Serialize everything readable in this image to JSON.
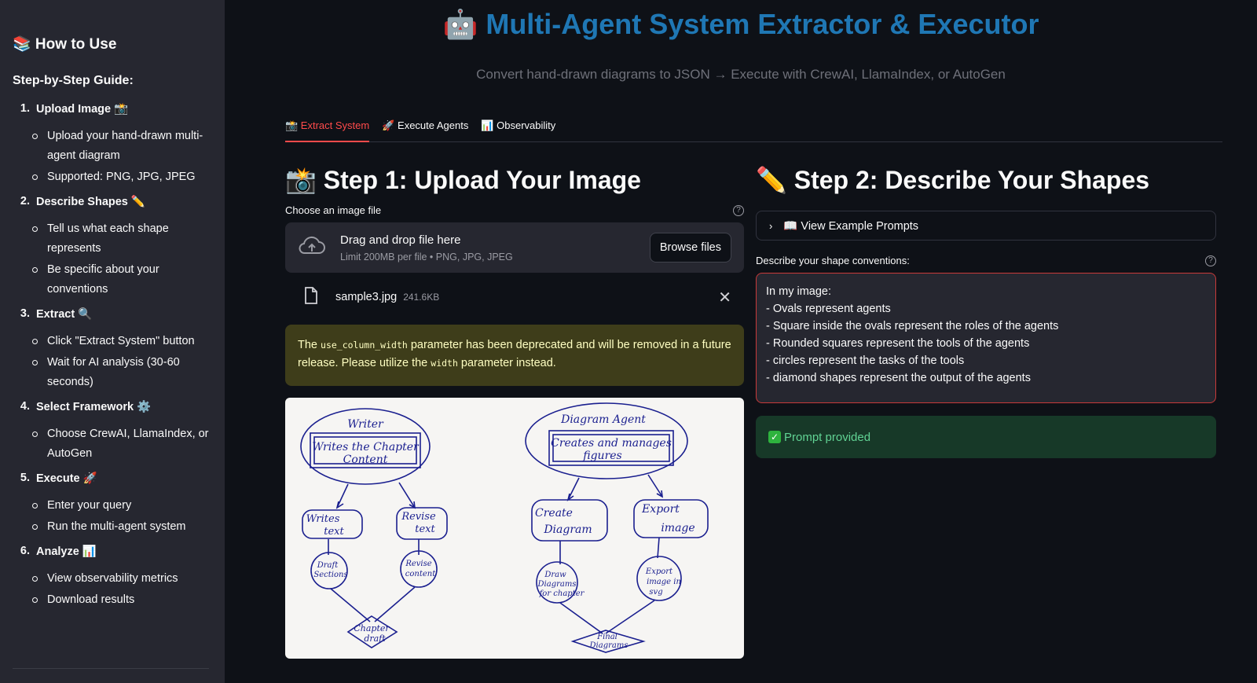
{
  "sidebar": {
    "title": "📚 How to Use",
    "guide_heading": "Step-by-Step Guide:",
    "steps": [
      {
        "num": "1.",
        "label": "Upload Image 📸",
        "bullets": [
          "Upload your hand-drawn multi-agent diagram",
          "Supported: PNG, JPG, JPEG"
        ]
      },
      {
        "num": "2.",
        "label": "Describe Shapes ✏️",
        "bullets": [
          "Tell us what each shape represents",
          "Be specific about your conventions"
        ]
      },
      {
        "num": "3.",
        "label": "Extract 🔍",
        "bullets": [
          "Click \"Extract System\" button",
          "Wait for AI analysis (30-60 seconds)"
        ]
      },
      {
        "num": "4.",
        "label": "Select Framework ⚙️",
        "bullets": [
          "Choose CrewAI, LlamaIndex, or AutoGen"
        ]
      },
      {
        "num": "5.",
        "label": "Execute 🚀",
        "bullets": [
          "Enter your query",
          "Run the multi-agent system"
        ]
      },
      {
        "num": "6.",
        "label": "Analyze 📊",
        "bullets": [
          "View observability metrics",
          "Download results"
        ]
      }
    ]
  },
  "header": {
    "title": "🤖 Multi-Agent System Extractor & Executor",
    "subtitle": "Convert hand-drawn diagrams to JSON → Execute with CrewAI, LlamaIndex, or AutoGen"
  },
  "tabs": [
    "📸 Extract System",
    "🚀 Execute Agents",
    "📊 Observability"
  ],
  "step1": {
    "heading": "📸 Step 1: Upload Your Image",
    "file_label": "Choose an image file",
    "drop_text": "Drag and drop file here",
    "limit_text": "Limit 200MB per file • PNG, JPG, JPEG",
    "browse_label": "Browse files",
    "file_name": "sample3.jpg",
    "file_size": "241.6KB",
    "warning": {
      "pre": "The ",
      "code1": "use_column_width",
      "mid": " parameter has been deprecated and will be removed in a future release. Please utilize the ",
      "code2": "width",
      "post": " parameter instead."
    },
    "diagram": {
      "left_agent": [
        "Writer",
        "Writes the Chapter",
        "Content"
      ],
      "right_agent": [
        "Diagram Agent",
        "Creates and manages",
        "figures"
      ],
      "tools": [
        [
          "Writes",
          "text"
        ],
        [
          "Revise",
          "text"
        ],
        [
          "Create",
          "Diagram"
        ],
        [
          "Export",
          "image"
        ]
      ],
      "tasks": [
        [
          "Draft",
          "Sections"
        ],
        [
          "Revise",
          "content"
        ],
        [
          "Draw",
          "Diagrams",
          "for chapter"
        ],
        [
          "Export",
          "image in",
          "svg"
        ]
      ],
      "outputs": [
        [
          "Chapter",
          "draft"
        ],
        [
          "Final",
          "Diagrams"
        ]
      ]
    }
  },
  "step2": {
    "heading": "✏️ Step 2: Describe Your Shapes",
    "expander_label": "📖 View Example Prompts",
    "describe_label": "Describe your shape conventions:",
    "prompt_text": "In my image:\n- Ovals represent agents\n- Square inside the ovals represent the roles of the agents\n- Rounded squares represent the tools of the agents\n- circles represent the tasks of the tools\n- diamond shapes represent the output of the agents",
    "success_text": "Prompt provided"
  },
  "colors": {
    "accent": "#ff4b4b",
    "title_blue": "#1f77b4",
    "success_green": "#61d394"
  }
}
